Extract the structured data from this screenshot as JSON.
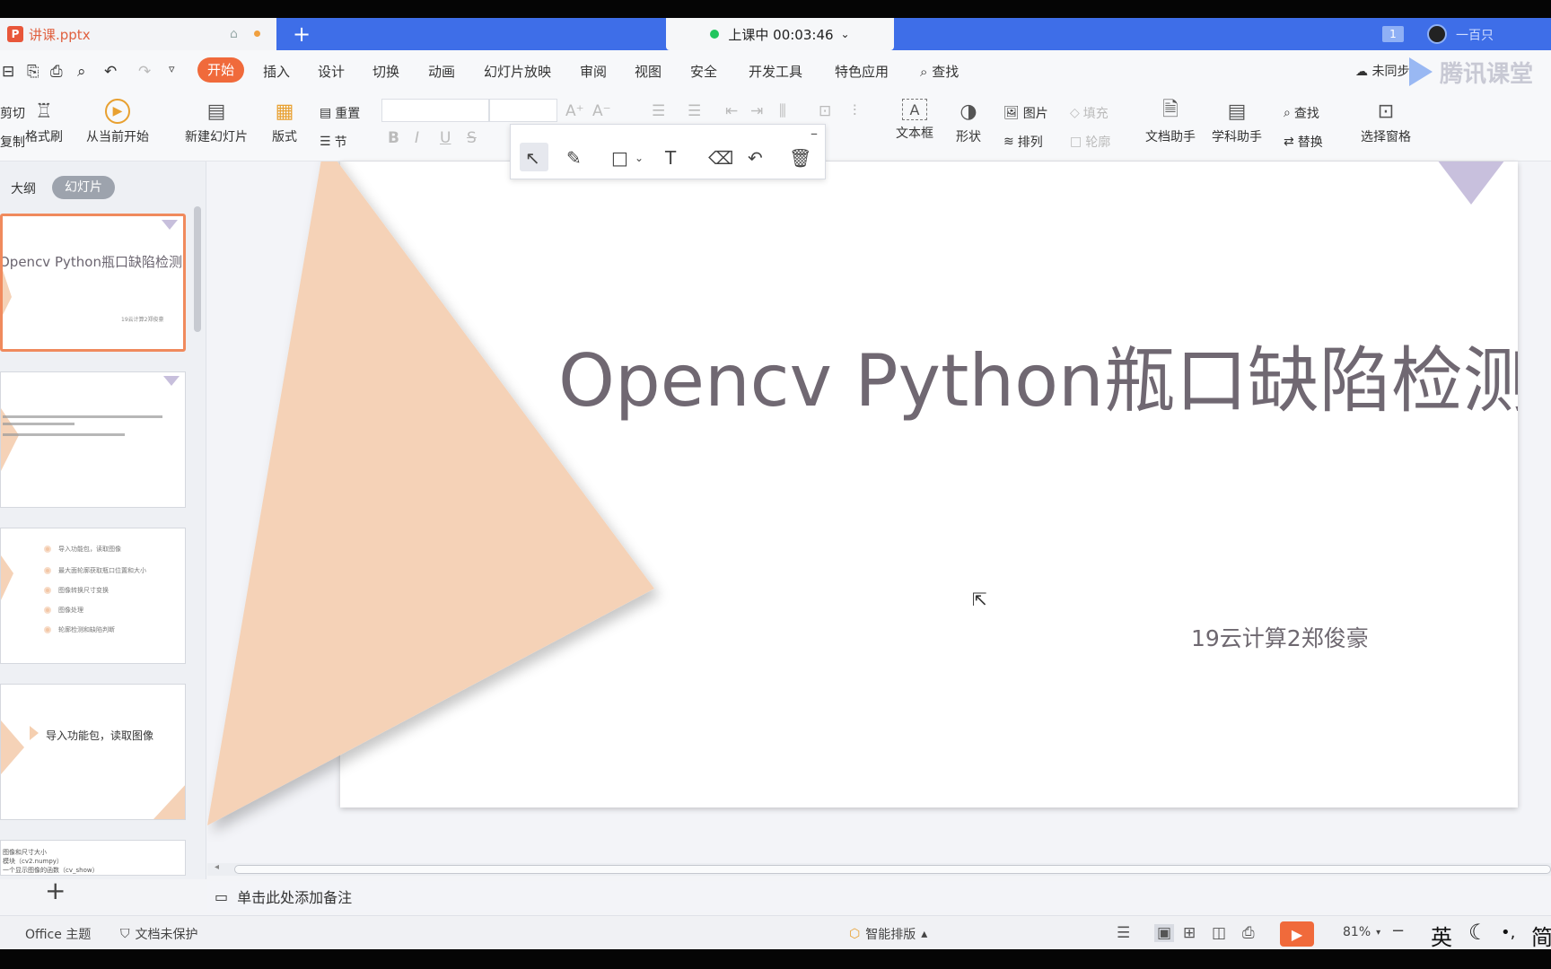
{
  "titlebar": {
    "doc_name": "讲课.pptx",
    "class_status": "上课中 00:03:46",
    "badge": "1",
    "user_name": "一百只"
  },
  "menu": {
    "items": [
      "开始",
      "插入",
      "设计",
      "切换",
      "动画",
      "幻灯片放映",
      "审阅",
      "视图",
      "安全",
      "开发工具",
      "特色应用"
    ],
    "search": "查找",
    "cloud": "未同步",
    "watermark": "腾讯课堂"
  },
  "ribbon": {
    "cut": "剪切",
    "copy": "复制",
    "format_painter": "格式刷",
    "from_current": "从当前开始",
    "new_slide": "新建幻灯片",
    "layout": "版式",
    "reset": "重置",
    "section": "节",
    "textbox": "文本框",
    "shape": "形状",
    "picture": "图片",
    "arrange": "排列",
    "fill": "填充",
    "outline": "轮廓",
    "doc_assistant": "文档助手",
    "subject_assistant": "学科助手",
    "find": "查找",
    "replace": "替换",
    "select_pane": "选择窗格"
  },
  "left_panel": {
    "tab_outline": "大纲",
    "tab_slides": "幻灯片",
    "thumb1_title": "Opencv Python瓶口缺陷检测",
    "thumb1_sub": "19云计算2郑俊豪",
    "thumb3_items": [
      "导入功能包，读取图像",
      "最大面轮廓获取瓶口位置和大小",
      "图像转换尺寸变换",
      "图像处理",
      "轮廓检测和缺陷判断"
    ],
    "thumb4_text": "导入功能包，读取图像",
    "thumb5_lines": [
      "图像和尺寸大小",
      "模块（cv2.numpy）",
      "一个显示图像的函数（cv_show）"
    ]
  },
  "slide": {
    "title": "Opencv Python瓶口缺陷检测",
    "subtitle": "19云计算2郑俊豪"
  },
  "notes": {
    "placeholder": "单击此处添加备注"
  },
  "status": {
    "theme": "Office 主题",
    "protect": "文档未保护",
    "smart_layout": "智能排版",
    "zoom": "81%",
    "ime_lang": "英",
    "ime_mode": "简"
  },
  "colors": {
    "accent": "#f06a3b",
    "titlebar": "#3e6ee8",
    "peach": "#f5d2b7",
    "lavender": "#c8c0dd"
  }
}
